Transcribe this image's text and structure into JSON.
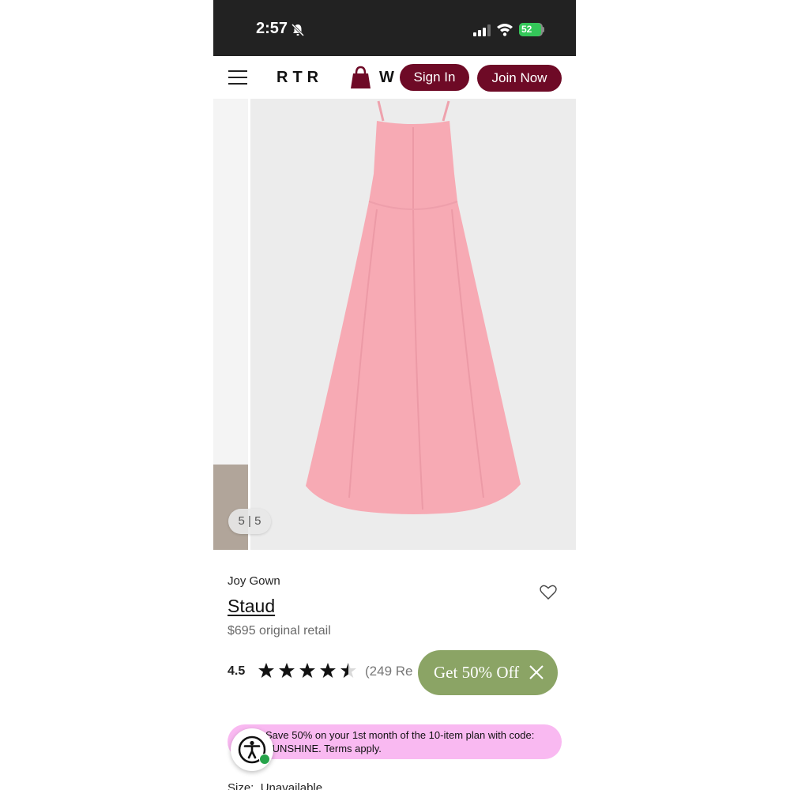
{
  "status_bar": {
    "time": "2:57",
    "battery": "52",
    "battery_level": 0.52
  },
  "header": {
    "logo": "RTR",
    "partial_logo": "W",
    "sign_in": "Sign In",
    "join_now": "Join Now"
  },
  "gallery": {
    "counter": "5 | 5"
  },
  "product": {
    "name": "Joy Gown",
    "designer": "Staud",
    "price": "$695 original retail",
    "rating": "4.5",
    "rating_value": 4.5,
    "reviews": "(249 Re"
  },
  "promo_chip": {
    "label": "Get 50% Off"
  },
  "banner": {
    "text": "Save 50% on your 1st month of the 10-item plan with code: SUNSHINE. Terms apply."
  },
  "size": {
    "label": "Size:",
    "value": "Unavailable"
  },
  "colors": {
    "brand": "#6e0a26",
    "promo": "#8ba465",
    "banner": "#f9b9f1",
    "dress": "#f7aab4"
  },
  "icons": [
    "menu-icon",
    "bag-icon",
    "heart-icon",
    "star-icon",
    "close-icon",
    "accessibility-icon",
    "bell-slash-icon",
    "wifi-icon",
    "signal-icon",
    "battery-icon"
  ]
}
